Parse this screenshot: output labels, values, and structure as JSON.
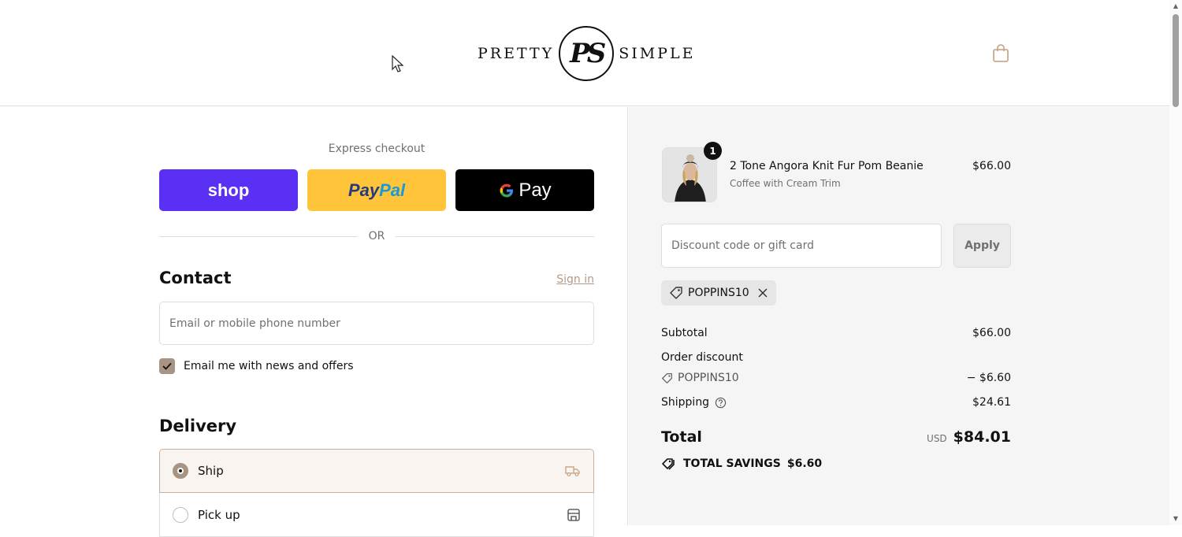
{
  "header": {
    "logo_left": "PRETTY",
    "logo_mono": "PS",
    "logo_right": "SIMPLE",
    "cart_icon": "shopping-bag-icon"
  },
  "express": {
    "label": "Express checkout",
    "shop_label": "shop",
    "paypal_label_1": "Pay",
    "paypal_label_2": "Pal",
    "gpay_label": "Pay",
    "or": "OR"
  },
  "contact": {
    "title": "Contact",
    "signin": "Sign in",
    "email_placeholder": "Email or mobile phone number",
    "news_label": "Email me with news and offers",
    "news_checked": true
  },
  "delivery": {
    "title": "Delivery",
    "options": [
      {
        "label": "Ship",
        "selected": true,
        "icon": "truck-icon"
      },
      {
        "label": "Pick up",
        "selected": false,
        "icon": "store-icon"
      }
    ]
  },
  "summary": {
    "quantity": "1",
    "product_name": "2 Tone Angora Knit Fur Pom Beanie",
    "product_variant": "Coffee with Cream Trim",
    "product_price": "$66.00",
    "discount_placeholder": "Discount code or gift card",
    "apply_label": "Apply",
    "applied_code": "POPPINS10",
    "subtotal_label": "Subtotal",
    "subtotal_value": "$66.00",
    "order_discount_label": "Order discount",
    "discount_code": "POPPINS10",
    "discount_value": "− $6.60",
    "shipping_label": "Shipping",
    "shipping_value": "$24.61",
    "total_label": "Total",
    "currency": "USD",
    "total_value": "$84.01",
    "savings_label": "TOTAL SAVINGS",
    "savings_value": "$6.60"
  },
  "colors": {
    "shop_purple": "#5a31f4",
    "paypal_yellow": "#ffc439",
    "accent_tan": "#a89484"
  }
}
